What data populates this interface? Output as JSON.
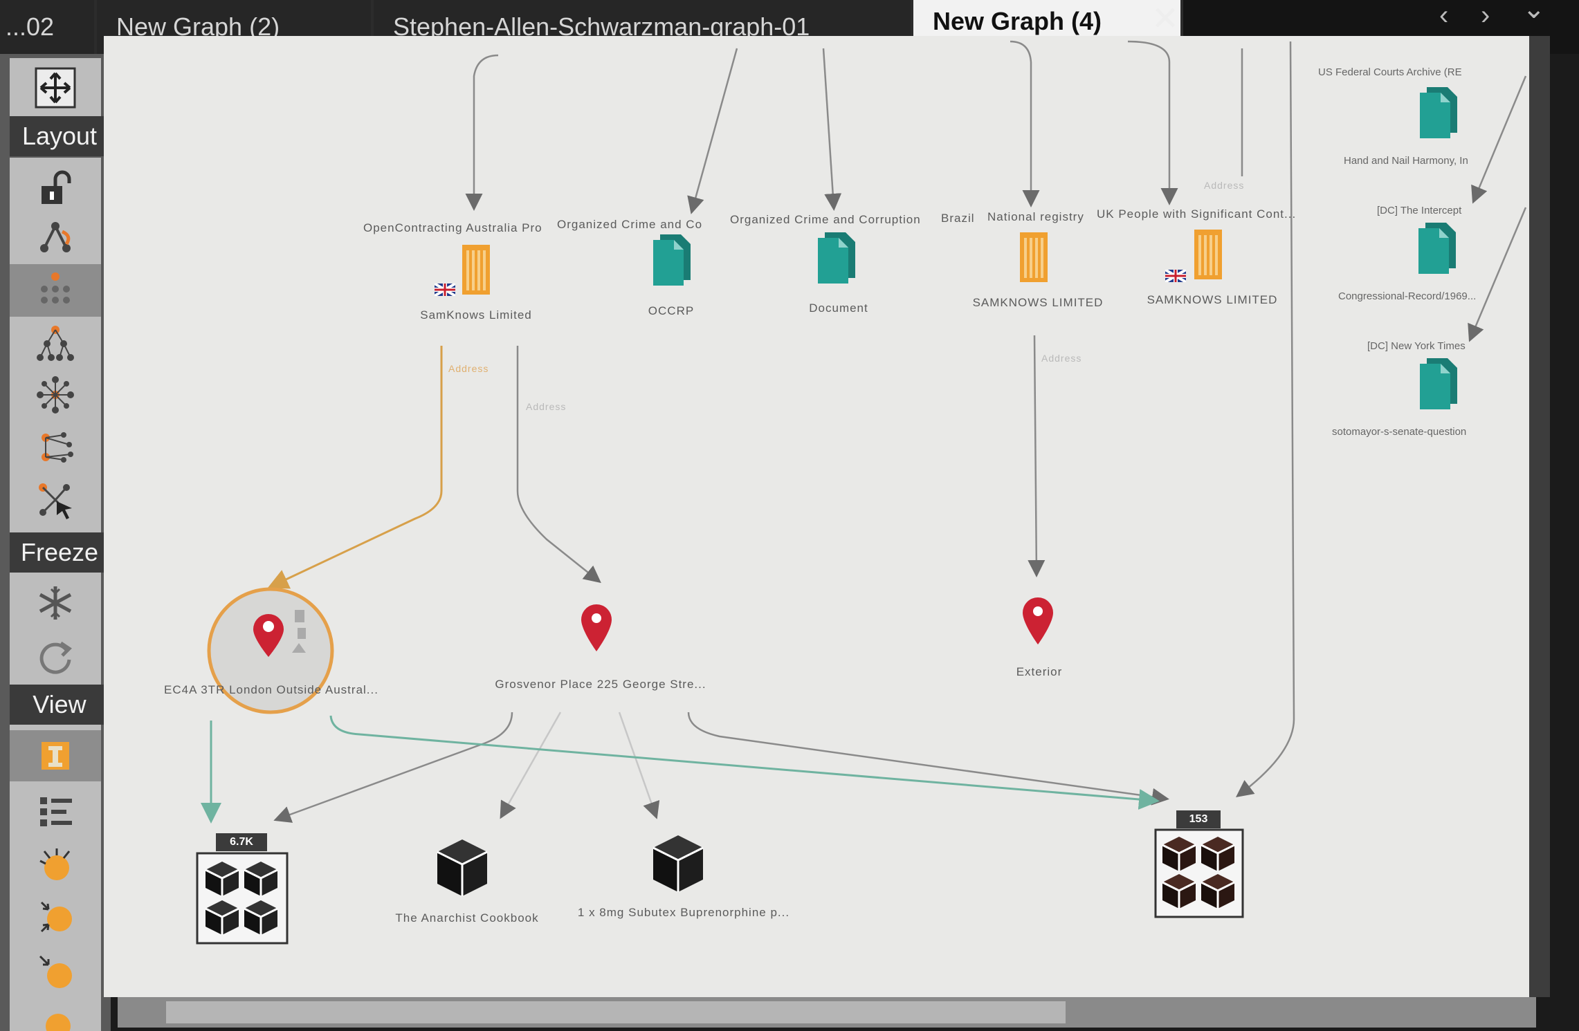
{
  "tabs": [
    {
      "label": "...02"
    },
    {
      "label": "New Graph (2)"
    },
    {
      "label": "Stephen-Allen-Schwarzman-graph-01"
    },
    {
      "label": "New Graph (4)"
    }
  ],
  "tab_close": "✕",
  "nav": {
    "back": "‹",
    "forward": "›",
    "menu": "⌄"
  },
  "sidebar": {
    "layout_label": "Layout",
    "freeze_label": "Freeze",
    "view_label": "View"
  },
  "graph": {
    "top_labels": [
      "OpenContracting Australia Pro",
      "Organized Crime and Co",
      "Organized Crime and Corruption",
      "Brazil",
      "National registry",
      "UK People with Significant Cont..."
    ],
    "nodes": {
      "samknows_limited": "SamKnows Limited",
      "occrp": "OCCRP",
      "document": "Document",
      "samknows_1": "SAMKNOWS LIMITED",
      "samknows_2": "SAMKNOWS LIMITED",
      "ec4a": "EC4A 3TR London Outside Austral...",
      "grosvenor": "Grosvenor Place 225 George Stre...",
      "exterior": "Exterior",
      "anarchist": "The Anarchist Cookbook",
      "subutex": "1 x 8mg Subutex Buprenorphine p..."
    },
    "edge_labels": {
      "address": "Address"
    },
    "badges": {
      "left_cluster": "6.7K",
      "right_cluster": "153"
    }
  },
  "right_panel": [
    "US Federal Courts Archive (RE",
    "Hand and Nail Harmony, In",
    "[DC] The Intercept",
    "Congressional-Record/1969...",
    "[DC] New York Times",
    "sotomayor-s-senate-question"
  ],
  "colors": {
    "canvas": "#e9e9e7",
    "document": "#1f8f86",
    "company": "#f0a030",
    "pin": "#cc2233",
    "edge_orange": "#d7a04a",
    "edge_teal": "#6fb3a0",
    "edge_gray": "#6b6b6b"
  }
}
